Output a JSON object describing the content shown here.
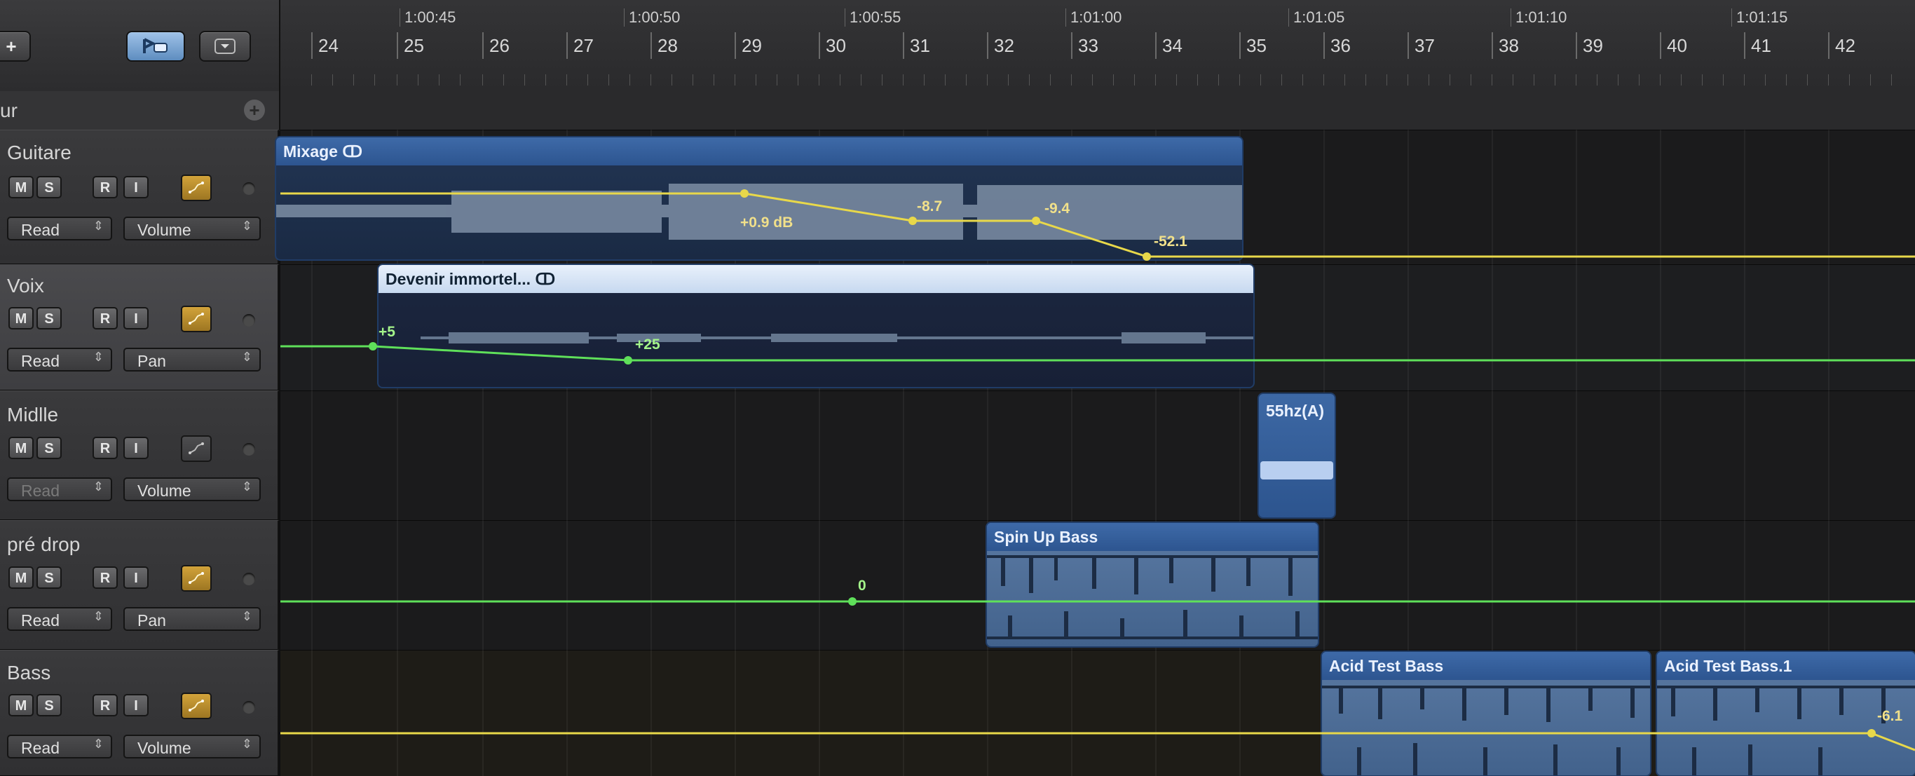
{
  "header": {
    "add_label": "+",
    "global_track_label": "ur"
  },
  "ruler": {
    "times": [
      "1:00:45",
      "1:00:50",
      "1:00:55",
      "1:01:00",
      "1:01:05",
      "1:01:10",
      "1:01:15"
    ],
    "bars": [
      "24",
      "25",
      "26",
      "27",
      "28",
      "29",
      "30",
      "31",
      "32",
      "33",
      "34",
      "35",
      "36",
      "37",
      "38",
      "39",
      "40",
      "41",
      "42"
    ]
  },
  "tracks": [
    {
      "name": "Guitare",
      "mute": "M",
      "solo": "S",
      "record": "R",
      "input": "I",
      "mode": "Read",
      "param": "Volume",
      "automation_on": true
    },
    {
      "name": "Voix",
      "mute": "M",
      "solo": "S",
      "record": "R",
      "input": "I",
      "mode": "Read",
      "param": "Pan",
      "automation_on": true
    },
    {
      "name": "Midlle",
      "mute": "M",
      "solo": "S",
      "record": "R",
      "input": "I",
      "mode": "Read",
      "param": "Volume",
      "automation_on": false
    },
    {
      "name": "pré drop",
      "mute": "M",
      "solo": "S",
      "record": "R",
      "input": "I",
      "mode": "Read",
      "param": "Pan",
      "automation_on": true
    },
    {
      "name": "Bass",
      "mute": "M",
      "solo": "S",
      "record": "R",
      "input": "I",
      "mode": "Read",
      "param": "Volume",
      "automation_on": true
    }
  ],
  "regions": {
    "mixage": "Mixage",
    "devenir": "Devenir immortel...",
    "hz55": "55hz(A)",
    "spin": "Spin Up Bass",
    "acid1": "Acid Test Bass",
    "acid2": "Acid Test Bass.1"
  },
  "automation_labels": {
    "guitare": [
      "+0.9 dB",
      "-8.7",
      "-9.4",
      "-52.1"
    ],
    "voix": [
      "+5",
      "+25"
    ],
    "predrop": [
      "0"
    ],
    "bass": [
      "-6.1"
    ]
  },
  "colors": {
    "region_blue": "#2d5590",
    "volume_line": "#e8d84a",
    "pan_line": "#5fe05a",
    "automation_button": "#c09030"
  },
  "icons": {
    "add": "plus-icon",
    "catch": "catch-icon",
    "options": "disclosure-icon",
    "loop": "loop-icon",
    "automation": "automation-curve-icon"
  }
}
